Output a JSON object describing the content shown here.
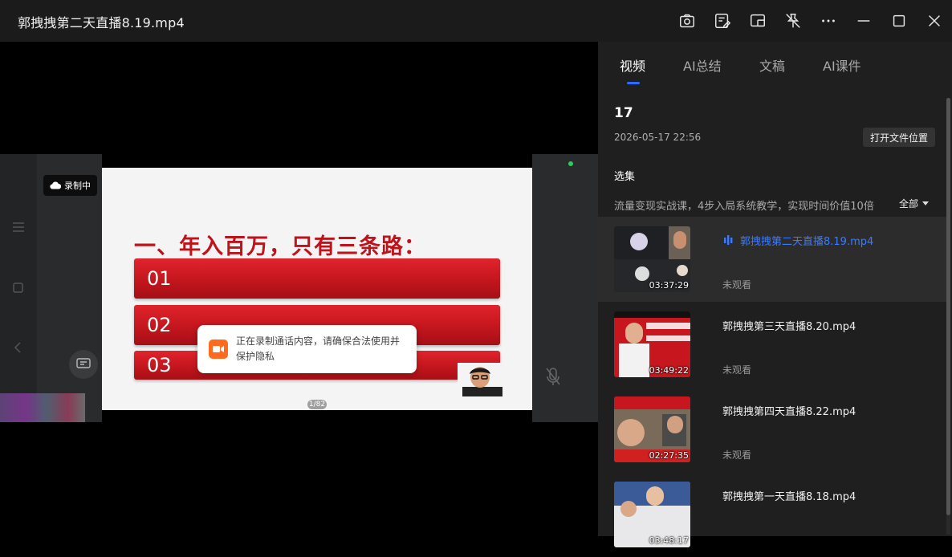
{
  "window": {
    "title": "郭拽拽第二天直播8.19.mp4",
    "buttons": [
      "screenshot-icon",
      "edit-note-icon",
      "picture-in-picture-icon",
      "pin-off-icon",
      "more-icon",
      "minimize-icon",
      "maximize-icon",
      "close-icon"
    ]
  },
  "player": {
    "rec_badge": "录制中",
    "slide": {
      "title": "一、年入百万，只有三条路：",
      "bars": [
        "01",
        "02",
        "03"
      ],
      "page_indicator": "1/82"
    },
    "toast": "正在录制通话内容，请确保合法使用并保护隐私"
  },
  "side": {
    "tabs": [
      {
        "label": "视频",
        "active": true
      },
      {
        "label": "AI总结",
        "active": false
      },
      {
        "label": "文稿",
        "active": false
      },
      {
        "label": "AI课件",
        "active": false
      }
    ],
    "name": "17",
    "date": "2026-05-17 22:56",
    "open_folder": "打开文件位置",
    "series_label": "选集",
    "series_desc": "流量变现实战课，4步入局系统教学，实现时间价值10倍",
    "all_label": "全部",
    "items": [
      {
        "title": "郭拽拽第二天直播8.19.mp4",
        "duration": "03:37:29",
        "status": "未观看",
        "active": true
      },
      {
        "title": "郭拽拽第三天直播8.20.mp4",
        "duration": "03:49:22",
        "status": "未观看",
        "active": false
      },
      {
        "title": "郭拽拽第四天直播8.22.mp4",
        "duration": "02:27:35",
        "status": "未观看",
        "active": false
      },
      {
        "title": "郭拽拽第一天直播8.18.mp4",
        "duration": "03:48:17",
        "status": "",
        "active": false
      }
    ]
  },
  "colors": {
    "accent": "#2b6cff",
    "slide_red": "#c0121a",
    "toast_icon": "#ff6a1f"
  }
}
